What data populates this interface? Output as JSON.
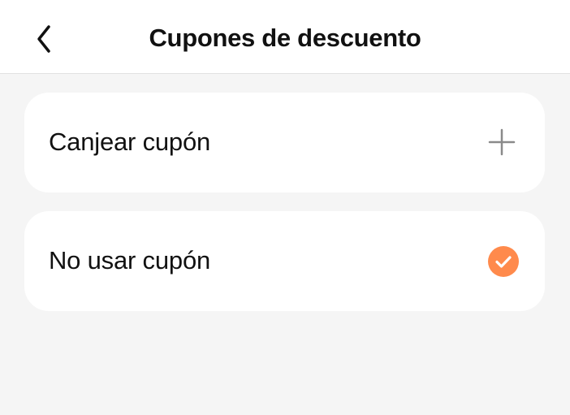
{
  "header": {
    "title": "Cupones de descuento",
    "back_icon": "chevron-left-icon"
  },
  "options": [
    {
      "label": "Canjear cupón",
      "icon": "plus-icon",
      "selected": false
    },
    {
      "label": "No usar cupón",
      "icon": "check-circle-icon",
      "selected": true
    }
  ],
  "colors": {
    "accent": "#ff8a4c",
    "background": "#f5f5f5",
    "card": "#ffffff",
    "text": "#111111",
    "icon_gray": "#8a8a8a"
  }
}
